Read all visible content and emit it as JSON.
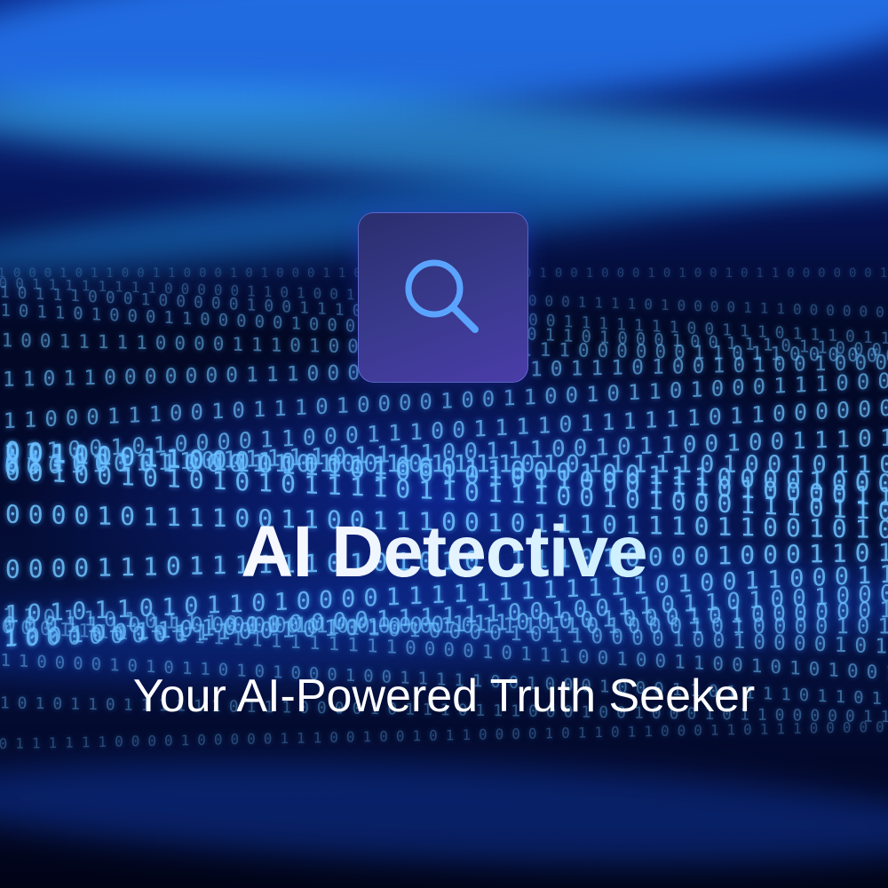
{
  "hero": {
    "icon": "search-icon",
    "title": "AI Detective",
    "subtitle": "Your AI-Powered Truth Seeker"
  },
  "colors": {
    "icon_tile_top": "#2a2f6e",
    "icon_tile_bottom": "#4a3ca8",
    "icon_stroke": "#5aa4ff",
    "title_gradient_end": "#a9e9ff",
    "background": "#020824"
  }
}
